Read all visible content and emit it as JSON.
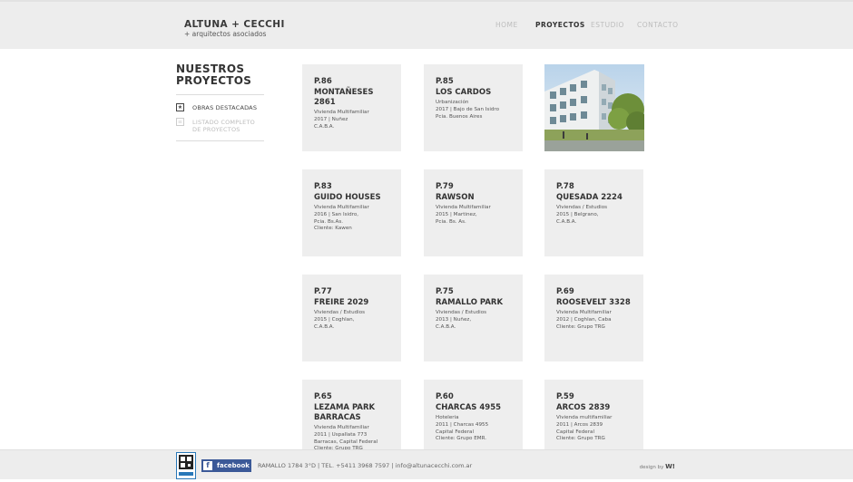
{
  "header": {
    "logo_title": "ALTUNA + CECCHI",
    "logo_subtitle": "+ arquitectos asociados",
    "nav": [
      "HOME",
      "PROYECTOS",
      "ESTUDIO",
      "CONTACTO"
    ],
    "active_nav": "PROYECTOS"
  },
  "sidebar": {
    "title_line1": "NUESTROS",
    "title_line2": "PROYECTOS",
    "items": [
      {
        "label": "OBRAS DESTACADAS",
        "icon": "star-icon",
        "active": true
      },
      {
        "label_line1": "LISTADO COMPLETO",
        "label_line2": "DE PROYECTOS",
        "icon": "list-icon",
        "active": false
      }
    ]
  },
  "projects": [
    {
      "code": "P.86",
      "title": [
        "MONTAÑESES",
        "2861"
      ],
      "details": [
        "Vivienda Multifamiliar",
        "2017 | Nuñez",
        "C.A.B.A."
      ]
    },
    {
      "code": "P.85",
      "title": [
        "LOS CARDOS"
      ],
      "details": [
        "Urbanización",
        "2017 | Bajo de San Isidro",
        "Pcia. Buenos Aires"
      ]
    },
    {
      "code": "P.83",
      "title": [
        "GUIDO HOUSES"
      ],
      "details": [
        "Vivienda Multifamiliar",
        "2016 | San Isidro,",
        "Pcia. Bs.As.",
        "Cliente: Kawen"
      ]
    },
    {
      "code": "P.79",
      "title": [
        "RAWSON"
      ],
      "details": [
        "Vivienda Multifamiliar",
        "2015 | Martinez,",
        "Pcia. Bs. As."
      ]
    },
    {
      "code": "P.78",
      "title": [
        "QUESADA 2224"
      ],
      "details": [
        "Viviendas / Estudios",
        "2015 | Belgrano,",
        "C.A.B.A."
      ]
    },
    {
      "code": "P.77",
      "title": [
        "FREIRE 2029"
      ],
      "details": [
        "Viviendas / Estudios",
        "2015 | Coghlan,",
        "C.A.B.A."
      ]
    },
    {
      "code": "P.75",
      "title": [
        "RAMALLO PARK"
      ],
      "details": [
        "Viviendas / Estudios",
        "2013 | Nuñez,",
        "C.A.B.A."
      ]
    },
    {
      "code": "P.69",
      "title": [
        "ROOSEVELT 3328"
      ],
      "details": [
        "Vivienda Multifamiliar",
        "2012 | Coghlan, Caba",
        "Cliente: Grupo TRG"
      ]
    },
    {
      "code": "P.65",
      "title": [
        "LEZAMA PARK",
        "BARRACAS"
      ],
      "details": [
        "Vivienda Multifamiliar",
        "2011 | Uspallata 773",
        "Barracas, Capital Federal",
        "Cliente: Grupo TRG"
      ]
    },
    {
      "code": "P.60",
      "title": [
        "CHARCAS 4955"
      ],
      "details": [
        "Hoteleria",
        "2011 | Charcas 4955",
        "Capital Federal",
        "Cliente: Grupo EMR."
      ]
    },
    {
      "code": "P.59",
      "title": [
        "ARCOS 2839"
      ],
      "details": [
        "Vivienda multifamiliar",
        "2011 | Arcos 2839",
        "Capital Federal",
        "Cliente: Grupo TRG"
      ]
    }
  ],
  "footer": {
    "facebook_label": "facebook",
    "contact": "RAMALLO 1784 3°D | TEL. +5411 3968 7597 | info@altunacecchi.com.ar",
    "design_prefix": "design by",
    "design_mark": "W!"
  },
  "colors": {
    "header_bg": "#ededed",
    "card_bg": "#eeeeee",
    "facebook": "#3b5998"
  }
}
